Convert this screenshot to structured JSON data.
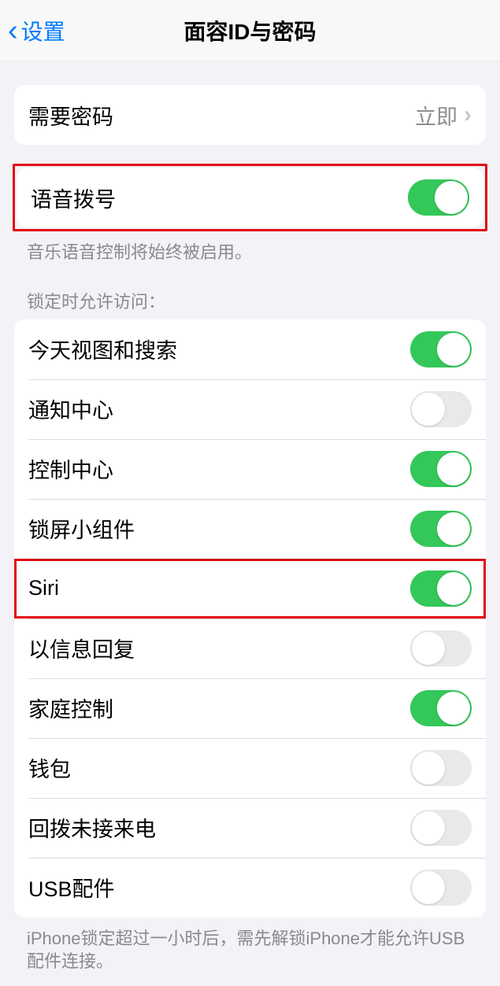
{
  "nav": {
    "back_label": "设置",
    "title": "面容ID与密码"
  },
  "passcode_row": {
    "label": "需要密码",
    "value": "立即"
  },
  "voice_dial": {
    "label": "语音拨号",
    "on": true,
    "footer": "音乐语音控制将始终被启用。"
  },
  "lock_access": {
    "header": "锁定时允许访问：",
    "items": [
      {
        "key": "today",
        "label": "今天视图和搜索",
        "on": true
      },
      {
        "key": "notifications",
        "label": "通知中心",
        "on": false
      },
      {
        "key": "control",
        "label": "控制中心",
        "on": true
      },
      {
        "key": "widgets",
        "label": "锁屏小组件",
        "on": true
      },
      {
        "key": "siri",
        "label": "Siri",
        "on": true
      },
      {
        "key": "reply",
        "label": "以信息回复",
        "on": false
      },
      {
        "key": "home",
        "label": "家庭控制",
        "on": true
      },
      {
        "key": "wallet",
        "label": "钱包",
        "on": false
      },
      {
        "key": "callback",
        "label": "回拨未接来电",
        "on": false
      },
      {
        "key": "usb",
        "label": "USB配件",
        "on": false
      }
    ],
    "footer": "iPhone锁定超过一小时后，需先解锁iPhone才能允许USB配件连接。"
  }
}
